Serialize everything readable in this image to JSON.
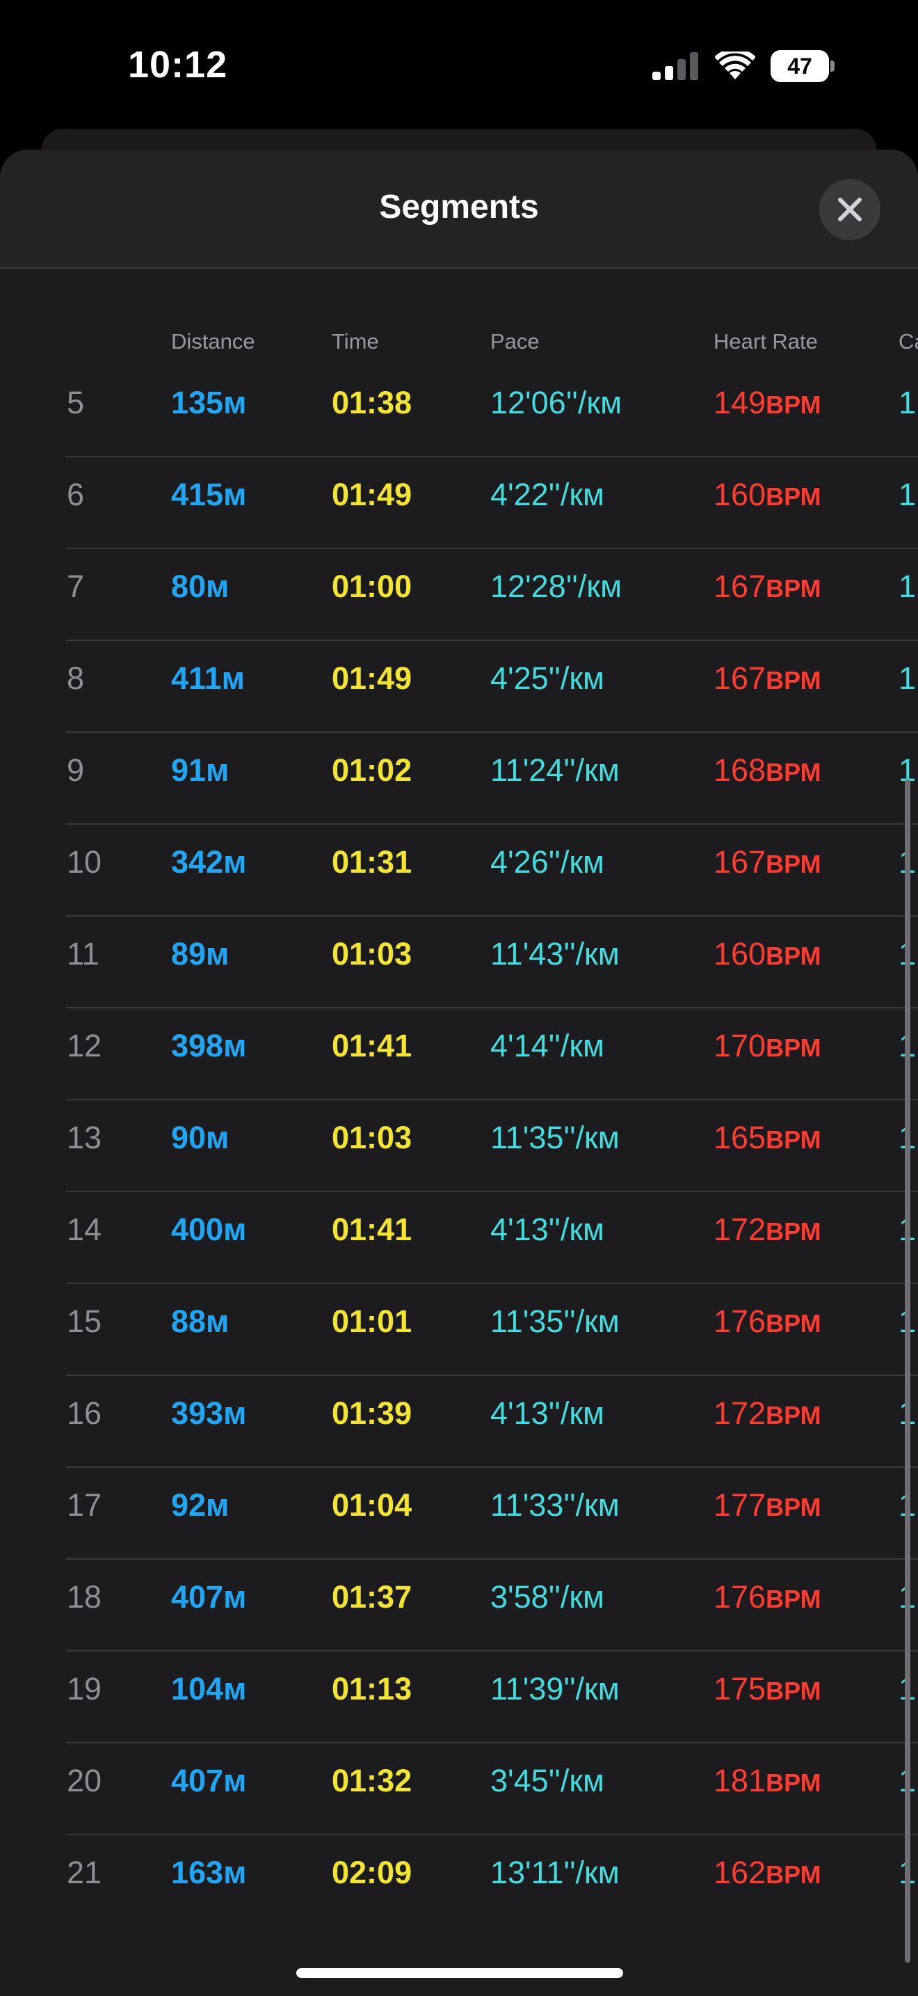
{
  "status_bar": {
    "time": "10:12",
    "battery": "47"
  },
  "sheet": {
    "title": "Segments",
    "close_icon": "close-icon"
  },
  "columns": {
    "distance": "Distance",
    "time": "Time",
    "pace": "Pace",
    "heart_rate": "Heart Rate",
    "cadence": "Ca"
  },
  "rows": [
    {
      "num": "5",
      "distance": "135м",
      "time": "01:38",
      "pace": "12'06''/км",
      "hr": "149",
      "hr_unit": "ВРМ",
      "cadence": "1"
    },
    {
      "num": "6",
      "distance": "415м",
      "time": "01:49",
      "pace": "4'22''/км",
      "hr": "160",
      "hr_unit": "ВРМ",
      "cadence": "1"
    },
    {
      "num": "7",
      "distance": "80м",
      "time": "01:00",
      "pace": "12'28''/км",
      "hr": "167",
      "hr_unit": "ВРМ",
      "cadence": "1"
    },
    {
      "num": "8",
      "distance": "411м",
      "time": "01:49",
      "pace": "4'25''/км",
      "hr": "167",
      "hr_unit": "ВРМ",
      "cadence": "1"
    },
    {
      "num": "9",
      "distance": "91м",
      "time": "01:02",
      "pace": "11'24''/км",
      "hr": "168",
      "hr_unit": "ВРМ",
      "cadence": "1"
    },
    {
      "num": "10",
      "distance": "342м",
      "time": "01:31",
      "pace": "4'26''/км",
      "hr": "167",
      "hr_unit": "ВРМ",
      "cadence": "1"
    },
    {
      "num": "11",
      "distance": "89м",
      "time": "01:03",
      "pace": "11'43''/км",
      "hr": "160",
      "hr_unit": "ВРМ",
      "cadence": "1"
    },
    {
      "num": "12",
      "distance": "398м",
      "time": "01:41",
      "pace": "4'14''/км",
      "hr": "170",
      "hr_unit": "ВРМ",
      "cadence": "1"
    },
    {
      "num": "13",
      "distance": "90м",
      "time": "01:03",
      "pace": "11'35''/км",
      "hr": "165",
      "hr_unit": "ВРМ",
      "cadence": "1"
    },
    {
      "num": "14",
      "distance": "400м",
      "time": "01:41",
      "pace": "4'13''/км",
      "hr": "172",
      "hr_unit": "ВРМ",
      "cadence": "1"
    },
    {
      "num": "15",
      "distance": "88м",
      "time": "01:01",
      "pace": "11'35''/км",
      "hr": "176",
      "hr_unit": "ВРМ",
      "cadence": "1"
    },
    {
      "num": "16",
      "distance": "393м",
      "time": "01:39",
      "pace": "4'13''/км",
      "hr": "172",
      "hr_unit": "ВРМ",
      "cadence": "1"
    },
    {
      "num": "17",
      "distance": "92м",
      "time": "01:04",
      "pace": "11'33''/км",
      "hr": "177",
      "hr_unit": "ВРМ",
      "cadence": "1"
    },
    {
      "num": "18",
      "distance": "407м",
      "time": "01:37",
      "pace": "3'58''/км",
      "hr": "176",
      "hr_unit": "ВРМ",
      "cadence": "1"
    },
    {
      "num": "19",
      "distance": "104м",
      "time": "01:13",
      "pace": "11'39''/км",
      "hr": "175",
      "hr_unit": "ВРМ",
      "cadence": "1"
    },
    {
      "num": "20",
      "distance": "407м",
      "time": "01:32",
      "pace": "3'45''/км",
      "hr": "181",
      "hr_unit": "ВРМ",
      "cadence": "1"
    },
    {
      "num": "21",
      "distance": "163м",
      "time": "02:09",
      "pace": "13'11''/км",
      "hr": "162",
      "hr_unit": "ВРМ",
      "cadence": "1"
    }
  ],
  "colors": {
    "distance": "#1fa7f5",
    "time": "#f5e42d",
    "pace": "#3fdde0",
    "heart_rate": "#ff3b30"
  }
}
